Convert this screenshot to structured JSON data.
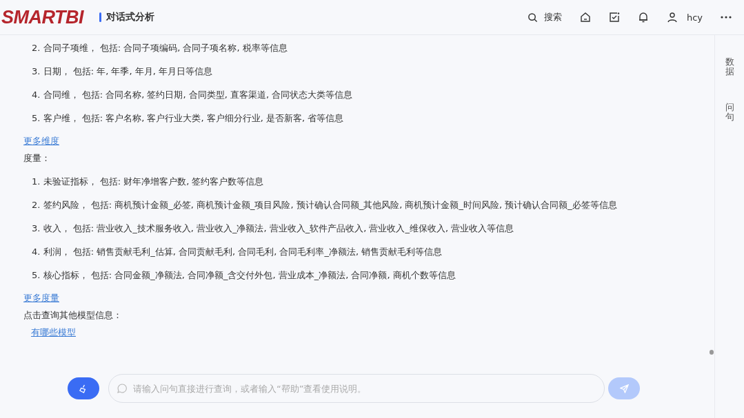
{
  "header": {
    "logo": "SMARTBI",
    "title": "对话式分析",
    "search_label": "搜索",
    "user": "hcy"
  },
  "dimensions": {
    "items": [
      "2. 合同子项维， 包括: 合同子项编码, 合同子项名称, 税率等信息",
      "3. 日期， 包括: 年, 年季, 年月, 年月日等信息",
      "4. 合同维， 包括: 合同名称, 签约日期, 合同类型, 直客渠道, 合同状态大类等信息",
      "5. 客户维， 包括: 客户名称, 客户行业大类, 客户细分行业, 是否新客, 省等信息"
    ],
    "more_link": "更多维度"
  },
  "measures": {
    "heading": "度量：",
    "items": [
      "1. 未验证指标， 包括: 财年净增客户数, 签约客户数等信息",
      "2. 签约风险， 包括: 商机预计金额_必签, 商机预计金额_项目风险, 预计确认合同额_其他风险, 商机预计金额_时间风险, 预计确认合同额_必签等信息",
      "3. 收入， 包括: 营业收入_技术服务收入, 营业收入_净额法, 营业收入_软件产品收入, 营业收入_维保收入, 营业收入等信息",
      "4. 利润， 包括: 销售贡献毛利_估算, 合同贡献毛利, 合同毛利, 合同毛利率_净额法, 销售贡献毛利等信息",
      "5. 核心指标， 包括: 合同金额_净额法, 合同净额_含交付外包, 营业成本_净额法, 合同净额, 商机个数等信息"
    ],
    "more_link": "更多度量"
  },
  "models": {
    "prompt": "点击查询其他模型信息：",
    "link": "有哪些模型"
  },
  "side_tabs": [
    {
      "label": "数据"
    },
    {
      "label": "问句"
    }
  ],
  "input": {
    "placeholder": "请输入问句直接进行查询，或者输入“帮助”查看使用说明。",
    "send_disabled": true
  }
}
